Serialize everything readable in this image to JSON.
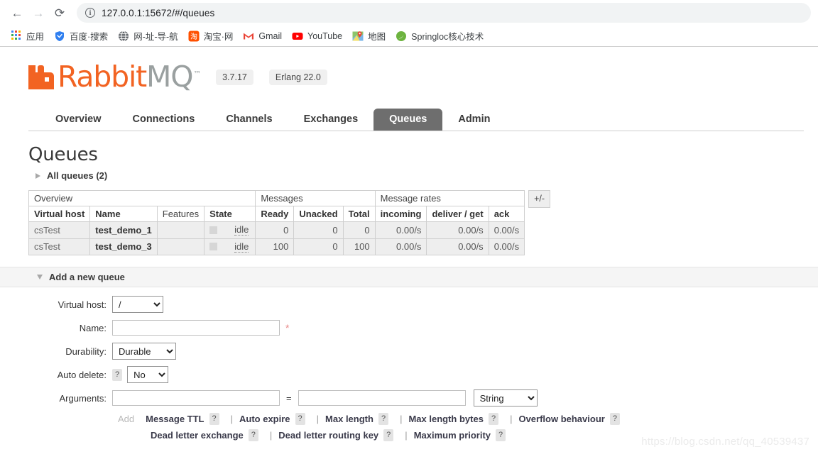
{
  "browser": {
    "back_icon": "back-arrow-icon",
    "forward_icon": "forward-arrow-icon",
    "reload_icon": "reload-icon",
    "site_info_icon": "info-icon",
    "url": "127.0.0.1:15672/#/queues",
    "bookmarks": [
      {
        "label": "应用",
        "icon": "apps-grid-icon"
      },
      {
        "label": "百度·搜索",
        "icon": "baidu-shield-icon"
      },
      {
        "label": "网-址-导-航",
        "icon": "globe-icon"
      },
      {
        "label": "淘宝·网",
        "icon": "taobao-icon"
      },
      {
        "label": "Gmail",
        "icon": "gmail-icon"
      },
      {
        "label": "YouTube",
        "icon": "youtube-icon"
      },
      {
        "label": "地图",
        "icon": "maps-pin-icon"
      },
      {
        "label": "Springloc核心技术",
        "icon": "spring-leaf-icon"
      }
    ]
  },
  "app": {
    "logo_text_primary": "Rabbit",
    "logo_text_secondary": "MQ",
    "logo_tm": "™",
    "version_badge": "3.7.17",
    "erlang_badge": "Erlang 22.0",
    "accent_color": "#f26322",
    "active_tab_color": "#6e6e6e"
  },
  "nav": {
    "tabs": [
      {
        "label": "Overview",
        "active": false
      },
      {
        "label": "Connections",
        "active": false
      },
      {
        "label": "Channels",
        "active": false
      },
      {
        "label": "Exchanges",
        "active": false
      },
      {
        "label": "Queues",
        "active": true
      },
      {
        "label": "Admin",
        "active": false
      }
    ]
  },
  "main": {
    "title": "Queues",
    "all_queues_label": "All queues (2)",
    "expand_icon": "triangle-right-icon",
    "plus_minus_label": "+/-"
  },
  "table": {
    "group_headers": [
      {
        "label": "Overview",
        "span": 4
      },
      {
        "label": "Messages",
        "span": 3
      },
      {
        "label": "Message rates",
        "span": 3
      }
    ],
    "columns": [
      {
        "label": "Virtual host",
        "bold": true,
        "align": "left"
      },
      {
        "label": "Name",
        "bold": true,
        "align": "left"
      },
      {
        "label": "Features",
        "bold": false,
        "align": "left"
      },
      {
        "label": "State",
        "bold": true,
        "align": "left"
      },
      {
        "label": "Ready",
        "bold": true,
        "align": "left"
      },
      {
        "label": "Unacked",
        "bold": true,
        "align": "left"
      },
      {
        "label": "Total",
        "bold": true,
        "align": "left"
      },
      {
        "label": "incoming",
        "bold": true,
        "align": "left"
      },
      {
        "label": "deliver / get",
        "bold": true,
        "align": "left"
      },
      {
        "label": "ack",
        "bold": true,
        "align": "left"
      }
    ],
    "rows": [
      {
        "vhost": "csTest",
        "name": "test_demo_1",
        "features": "",
        "state": "idle",
        "ready": "0",
        "unacked": "0",
        "total": "0",
        "incoming": "0.00/s",
        "deliver_get": "0.00/s",
        "ack": "0.00/s"
      },
      {
        "vhost": "csTest",
        "name": "test_demo_3",
        "features": "",
        "state": "idle",
        "ready": "100",
        "unacked": "0",
        "total": "100",
        "incoming": "0.00/s",
        "deliver_get": "0.00/s",
        "ack": "0.00/s"
      }
    ]
  },
  "add_queue": {
    "section_title": "Add a new queue",
    "collapse_icon": "triangle-down-icon",
    "fields": {
      "vhost_label": "Virtual host:",
      "vhost_value": "/",
      "name_label": "Name:",
      "name_value": "",
      "name_required_mark": "*",
      "durability_label": "Durability:",
      "durability_value": "Durable",
      "autodelete_label": "Auto delete:",
      "autodelete_help": "?",
      "autodelete_value": "No",
      "arguments_label": "Arguments:",
      "arg_key_value": "",
      "arg_val_value": "",
      "arg_equals": "=",
      "arg_type_value": "String"
    },
    "add_word": "Add",
    "presets_row1": [
      {
        "label": "Message TTL",
        "help": "?"
      },
      {
        "label": "Auto expire",
        "help": "?"
      },
      {
        "label": "Max length",
        "help": "?"
      },
      {
        "label": "Max length bytes",
        "help": "?"
      },
      {
        "label": "Overflow behaviour",
        "help": "?"
      }
    ],
    "presets_row2": [
      {
        "label": "Dead letter exchange",
        "help": "?"
      },
      {
        "label": "Dead letter routing key",
        "help": "?"
      },
      {
        "label": "Maximum priority",
        "help": "?"
      }
    ],
    "separator": "|"
  },
  "watermark": "https://blog.csdn.net/qq_40539437"
}
